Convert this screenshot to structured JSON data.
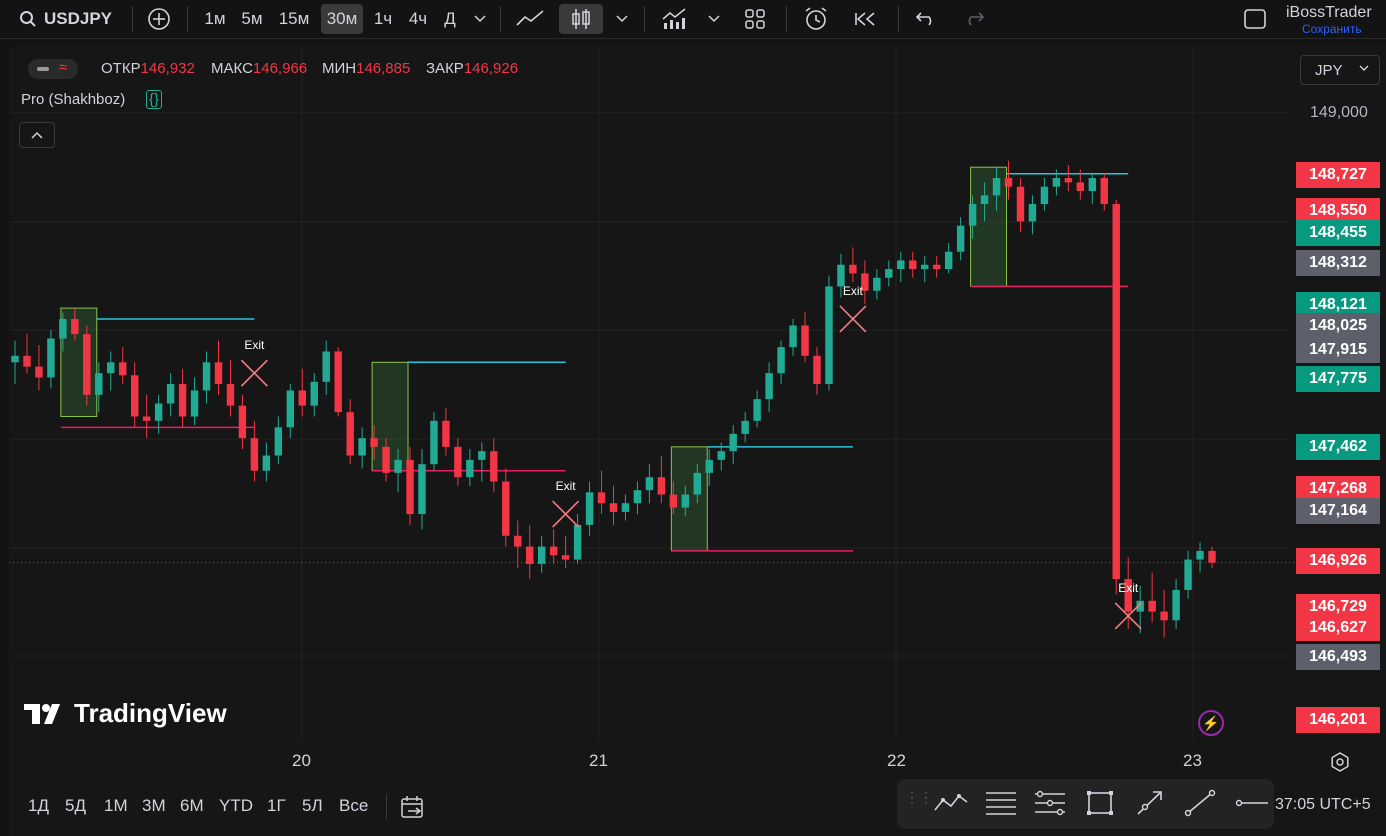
{
  "toolbar": {
    "symbol": "USDJPY",
    "intervals": [
      "1м",
      "5м",
      "15м",
      "30м",
      "1ч",
      "4ч",
      "Д"
    ],
    "active_interval": "30м",
    "account": "iBossTrader",
    "save_label": "Сохранить"
  },
  "legend": {
    "open_label": "ОТКР",
    "open": "146,932",
    "high_label": "МАКС",
    "high": "146,966",
    "low_label": "МИН",
    "low": "146,885",
    "close_label": "ЗАКР",
    "close": "146,926",
    "indicator": "Pro (Shakhboz)",
    "indicator_icon": "{}"
  },
  "currency": "JPY",
  "price_axis": {
    "top_label": "149,000",
    "labels": [
      {
        "text": "148,727",
        "color": "red"
      },
      {
        "text": "148,550",
        "color": "red"
      },
      {
        "text": "148,455",
        "color": "green"
      },
      {
        "text": "148,312",
        "color": "gray"
      },
      {
        "text": "148,121",
        "color": "green"
      },
      {
        "text": "148,025",
        "color": "gray"
      },
      {
        "text": "147,915",
        "color": "gray"
      },
      {
        "text": "147,775",
        "color": "green"
      },
      {
        "text": "147,462",
        "color": "green"
      },
      {
        "text": "147,268",
        "color": "red"
      },
      {
        "text": "147,164",
        "color": "gray"
      },
      {
        "text": "146,926",
        "color": "red"
      },
      {
        "text": "146,729",
        "color": "red"
      },
      {
        "text": "146,627",
        "color": "red"
      },
      {
        "text": "146,493",
        "color": "gray"
      },
      {
        "text": "146,201",
        "color": "red"
      }
    ]
  },
  "dates": [
    "20",
    "21",
    "22",
    "23"
  ],
  "exit_label": "Exit",
  "logo_text": "TradingView",
  "ranges": [
    "1Д",
    "5Д",
    "1М",
    "3М",
    "6М",
    "YTD",
    "1Г",
    "5Л",
    "Все"
  ],
  "clock": "37:05 UTC+5",
  "chart_data": {
    "type": "candlestick",
    "symbol": "USDJPY",
    "interval": "30м",
    "y_range": [
      146.2,
      149.0
    ],
    "last_price": 146.926,
    "candles": [
      [
        147.85,
        147.95,
        147.75,
        147.88
      ],
      [
        147.88,
        147.98,
        147.8,
        147.83
      ],
      [
        147.83,
        147.93,
        147.72,
        147.78
      ],
      [
        147.78,
        148.0,
        147.73,
        147.96
      ],
      [
        147.96,
        148.08,
        147.9,
        148.05
      ],
      [
        148.05,
        148.1,
        147.95,
        147.98
      ],
      [
        147.98,
        148.02,
        147.65,
        147.7
      ],
      [
        147.7,
        147.85,
        147.62,
        147.8
      ],
      [
        147.8,
        147.9,
        147.72,
        147.85
      ],
      [
        147.85,
        147.92,
        147.75,
        147.79
      ],
      [
        147.79,
        147.85,
        147.55,
        147.6
      ],
      [
        147.6,
        147.7,
        147.5,
        147.58
      ],
      [
        147.58,
        147.7,
        147.52,
        147.66
      ],
      [
        147.66,
        147.8,
        147.6,
        147.75
      ],
      [
        147.75,
        147.82,
        147.55,
        147.6
      ],
      [
        147.6,
        147.78,
        147.56,
        147.72
      ],
      [
        147.72,
        147.9,
        147.66,
        147.85
      ],
      [
        147.85,
        147.95,
        147.7,
        147.75
      ],
      [
        147.75,
        147.86,
        147.6,
        147.65
      ],
      [
        147.65,
        147.7,
        147.45,
        147.5
      ],
      [
        147.5,
        147.58,
        147.3,
        147.35
      ],
      [
        147.35,
        147.48,
        147.3,
        147.42
      ],
      [
        147.42,
        147.6,
        147.38,
        147.55
      ],
      [
        147.55,
        147.75,
        147.5,
        147.72
      ],
      [
        147.72,
        147.82,
        147.6,
        147.65
      ],
      [
        147.65,
        147.8,
        147.6,
        147.76
      ],
      [
        147.76,
        147.95,
        147.7,
        147.9
      ],
      [
        147.9,
        147.92,
        147.6,
        147.62
      ],
      [
        147.62,
        147.68,
        147.38,
        147.42
      ],
      [
        147.42,
        147.55,
        147.36,
        147.5
      ],
      [
        147.5,
        147.56,
        147.4,
        147.46
      ],
      [
        147.46,
        147.5,
        147.3,
        147.34
      ],
      [
        147.34,
        147.45,
        147.25,
        147.4
      ],
      [
        147.4,
        147.46,
        147.1,
        147.15
      ],
      [
        147.15,
        147.45,
        147.08,
        147.38
      ],
      [
        147.38,
        147.62,
        147.35,
        147.58
      ],
      [
        147.58,
        147.64,
        147.42,
        147.46
      ],
      [
        147.46,
        147.5,
        147.28,
        147.32
      ],
      [
        147.32,
        147.45,
        147.28,
        147.4
      ],
      [
        147.4,
        147.48,
        147.3,
        147.44
      ],
      [
        147.44,
        147.5,
        147.25,
        147.3
      ],
      [
        147.3,
        147.36,
        147.0,
        147.05
      ],
      [
        147.05,
        147.12,
        146.9,
        147.0
      ],
      [
        147.0,
        147.1,
        146.85,
        146.92
      ],
      [
        146.92,
        147.05,
        146.88,
        147.0
      ],
      [
        147.0,
        147.08,
        146.92,
        146.96
      ],
      [
        146.96,
        147.05,
        146.9,
        146.94
      ],
      [
        146.94,
        147.15,
        146.92,
        147.1
      ],
      [
        147.1,
        147.3,
        147.05,
        147.25
      ],
      [
        147.25,
        147.35,
        147.15,
        147.2
      ],
      [
        147.2,
        147.28,
        147.1,
        147.16
      ],
      [
        147.16,
        147.24,
        147.12,
        147.2
      ],
      [
        147.2,
        147.3,
        147.15,
        147.26
      ],
      [
        147.26,
        147.38,
        147.2,
        147.32
      ],
      [
        147.32,
        147.42,
        147.2,
        147.24
      ],
      [
        147.24,
        147.3,
        147.15,
        147.18
      ],
      [
        147.18,
        147.28,
        147.14,
        147.24
      ],
      [
        147.24,
        147.38,
        147.2,
        147.34
      ],
      [
        147.34,
        147.45,
        147.28,
        147.4
      ],
      [
        147.4,
        147.48,
        147.35,
        147.44
      ],
      [
        147.44,
        147.56,
        147.38,
        147.52
      ],
      [
        147.52,
        147.62,
        147.48,
        147.58
      ],
      [
        147.58,
        147.72,
        147.55,
        147.68
      ],
      [
        147.68,
        147.85,
        147.62,
        147.8
      ],
      [
        147.8,
        147.95,
        147.75,
        147.92
      ],
      [
        147.92,
        148.05,
        147.88,
        148.02
      ],
      [
        148.02,
        148.08,
        147.85,
        147.88
      ],
      [
        147.88,
        147.92,
        147.7,
        147.75
      ],
      [
        147.75,
        148.25,
        147.72,
        148.2
      ],
      [
        148.2,
        148.35,
        148.15,
        148.3
      ],
      [
        148.3,
        148.38,
        148.22,
        148.26
      ],
      [
        148.26,
        148.32,
        148.12,
        148.18
      ],
      [
        148.18,
        148.28,
        148.14,
        148.24
      ],
      [
        148.24,
        148.32,
        148.2,
        148.28
      ],
      [
        148.28,
        148.36,
        148.22,
        148.32
      ],
      [
        148.32,
        148.36,
        148.24,
        148.28
      ],
      [
        148.28,
        148.34,
        148.22,
        148.3
      ],
      [
        148.3,
        148.34,
        148.24,
        148.28
      ],
      [
        148.28,
        148.4,
        148.26,
        148.36
      ],
      [
        148.36,
        148.52,
        148.32,
        148.48
      ],
      [
        148.48,
        148.62,
        148.42,
        148.58
      ],
      [
        148.58,
        148.68,
        148.5,
        148.62
      ],
      [
        148.62,
        148.75,
        148.55,
        148.7
      ],
      [
        148.7,
        148.78,
        148.6,
        148.66
      ],
      [
        148.66,
        148.7,
        148.45,
        148.5
      ],
      [
        148.5,
        148.62,
        148.44,
        148.58
      ],
      [
        148.58,
        148.7,
        148.55,
        148.66
      ],
      [
        148.66,
        148.74,
        148.62,
        148.7
      ],
      [
        148.7,
        148.76,
        148.64,
        148.68
      ],
      [
        148.68,
        148.74,
        148.6,
        148.64
      ],
      [
        148.64,
        148.72,
        148.58,
        148.7
      ],
      [
        148.7,
        148.72,
        148.55,
        148.58
      ],
      [
        148.58,
        148.6,
        146.78,
        146.85
      ],
      [
        146.85,
        146.95,
        146.62,
        146.7
      ],
      [
        146.7,
        146.82,
        146.6,
        146.75
      ],
      [
        146.75,
        146.88,
        146.65,
        146.7
      ],
      [
        146.7,
        146.8,
        146.58,
        146.66
      ],
      [
        146.66,
        146.85,
        146.62,
        146.8
      ],
      [
        146.8,
        146.98,
        146.76,
        146.94
      ],
      [
        146.94,
        147.02,
        146.88,
        146.98
      ],
      [
        146.98,
        147.0,
        146.9,
        146.926
      ]
    ],
    "positions": [
      {
        "entry_range": [
          147.6,
          148.1
        ],
        "target": 148.05,
        "stop": 147.55,
        "exit": "Exit"
      },
      {
        "entry_range": [
          147.35,
          147.85
        ],
        "target": 147.85,
        "stop": 147.35,
        "exit": "Exit"
      },
      {
        "entry_range": [
          146.98,
          147.46
        ],
        "target": 147.46,
        "stop": 146.98,
        "exit": "Exit"
      },
      {
        "entry_range": [
          148.2,
          148.75
        ],
        "target": 148.72,
        "stop": 148.2,
        "exit": "Exit"
      }
    ]
  }
}
